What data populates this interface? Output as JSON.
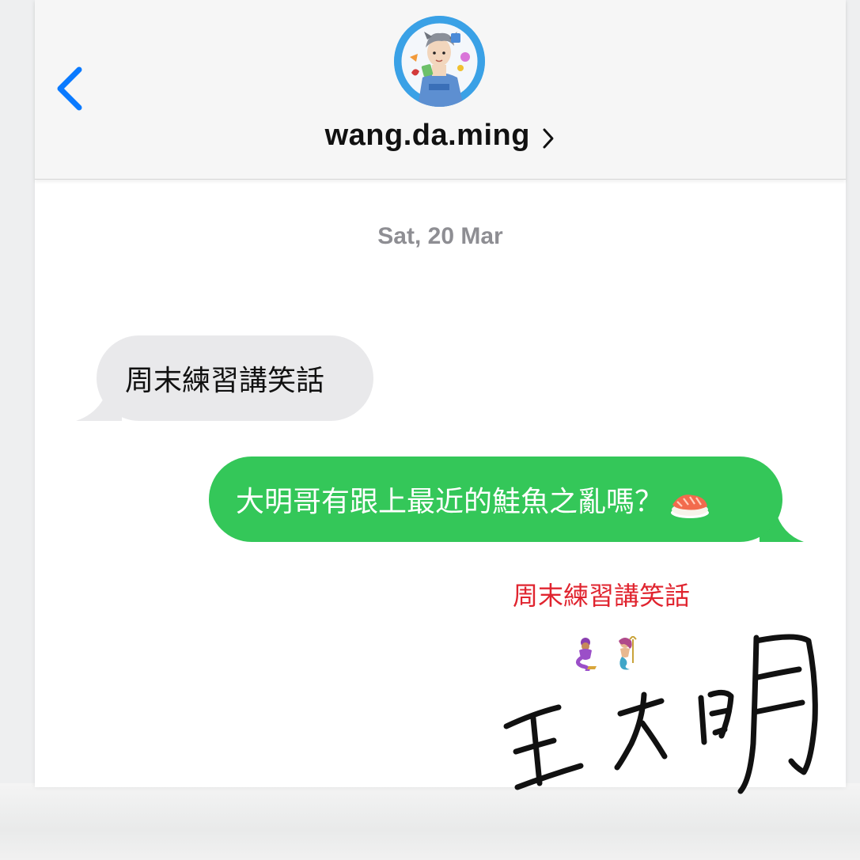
{
  "header": {
    "back_icon": "chevron-left-icon",
    "avatar_icon": "cartoon-avatar",
    "contact_name": "wang.da.ming",
    "contact_chevron_icon": "chevron-right-icon"
  },
  "conversation": {
    "date": "Sat, 20 Mar",
    "messages": [
      {
        "direction": "incoming",
        "text": "周末練習講笑話"
      },
      {
        "direction": "outgoing",
        "text": "大明哥有跟上最近的鮭魚之亂嗎？",
        "emoji": "sushi-icon"
      }
    ]
  },
  "overlay": {
    "caption": "周末練習講笑話",
    "emojis": [
      "genie-icon",
      "mermaid-icon"
    ],
    "signature": "王大明"
  },
  "colors": {
    "ios_blue": "#0a7aff",
    "incoming_bubble": "#e9e9eb",
    "outgoing_bubble": "#34c759",
    "date_text": "#8e8e93",
    "caption_red": "#e0242f"
  }
}
